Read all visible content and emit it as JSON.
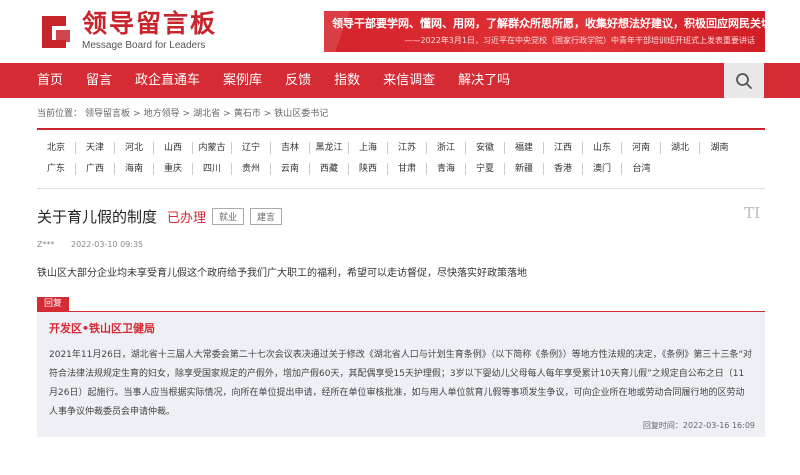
{
  "logo": {
    "title": "领导留言板",
    "subtitle": "Message Board for Leaders"
  },
  "banner": {
    "line1": "领导干部要学网、懂网、用网，了解群众所思所愿，收集好想法好建议，积极回应网民关切。",
    "line2": "——2022年3月1日，习近平在中央党校（国家行政学院）中青年干部培训班开班式上发表重要讲话"
  },
  "nav": {
    "items": [
      "首页",
      "留言",
      "政企直通车",
      "案例库",
      "反馈",
      "指数",
      "来信调查",
      "解决了吗"
    ]
  },
  "breadcrumb": {
    "prefix": "当前位置：",
    "items": [
      "领导留言板",
      ">",
      "地方领导",
      ">",
      "湖北省",
      ">",
      "黄石市",
      ">",
      "铁山区委书记"
    ]
  },
  "regions": {
    "row1": [
      "北京",
      "天津",
      "河北",
      "山西",
      "内蒙古",
      "辽宁",
      "吉林",
      "黑龙江",
      "上海",
      "江苏",
      "浙江",
      "安徽",
      "福建",
      "江西",
      "山东",
      "河南",
      "湖北",
      "湖南"
    ],
    "row2": [
      "广东",
      "广西",
      "海南",
      "重庆",
      "四川",
      "贵州",
      "云南",
      "西藏",
      "陕西",
      "甘肃",
      "青海",
      "宁夏",
      "新疆",
      "香港",
      "澳门",
      "台湾"
    ]
  },
  "message": {
    "title": "关于育儿假的制度",
    "status": "已办理",
    "tags": [
      "就业",
      "建言"
    ],
    "font_icon": "TI",
    "author": "Z***",
    "date": "2022-03-10 09:35",
    "content": "铁山区大部分企业均未享受育儿假这个政府给予我们广大职工的福利，希望可以走访督促，尽快落实好政策落地"
  },
  "reply": {
    "label": "回复",
    "org": "开发区•铁山区卫健局",
    "body": "2021年11月26日，湖北省十三届人大常委会第二十七次会议表决通过关于修改《湖北省人口与计划生育条例》（以下简称《条例》）等地方性法规的决定，《条例》第三十三条“对符合法律法规规定生育的妇女，除享受国家规定的产假外，增加产假60天，其配偶享受15天护理假；3岁以下婴幼儿父母每人每年享受累计10天育儿假”之规定自公布之日（11月26日）起施行。当事人应当根据实际情况，向所在单位提出申请，经所在单位审核批准，如与用人单位就育儿假等事项发生争议，可向企业所在地或劳动合同履行地的区劳动人事争议仲裁委员会申请仲裁。",
    "time_label": "回复时间：",
    "time": "2022-03-16 16:09"
  },
  "colors": {
    "brand_red": "#d42b34",
    "reply_bg": "#eef0f6"
  }
}
